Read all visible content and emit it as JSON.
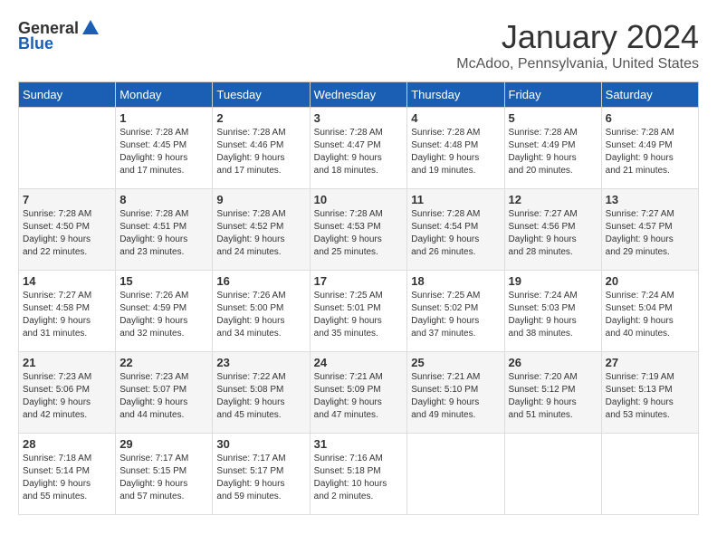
{
  "logo": {
    "general": "General",
    "blue": "Blue"
  },
  "title": "January 2024",
  "location": "McAdoo, Pennsylvania, United States",
  "days_of_week": [
    "Sunday",
    "Monday",
    "Tuesday",
    "Wednesday",
    "Thursday",
    "Friday",
    "Saturday"
  ],
  "weeks": [
    [
      {
        "day": "",
        "info": ""
      },
      {
        "day": "1",
        "info": "Sunrise: 7:28 AM\nSunset: 4:45 PM\nDaylight: 9 hours\nand 17 minutes."
      },
      {
        "day": "2",
        "info": "Sunrise: 7:28 AM\nSunset: 4:46 PM\nDaylight: 9 hours\nand 17 minutes."
      },
      {
        "day": "3",
        "info": "Sunrise: 7:28 AM\nSunset: 4:47 PM\nDaylight: 9 hours\nand 18 minutes."
      },
      {
        "day": "4",
        "info": "Sunrise: 7:28 AM\nSunset: 4:48 PM\nDaylight: 9 hours\nand 19 minutes."
      },
      {
        "day": "5",
        "info": "Sunrise: 7:28 AM\nSunset: 4:49 PM\nDaylight: 9 hours\nand 20 minutes."
      },
      {
        "day": "6",
        "info": "Sunrise: 7:28 AM\nSunset: 4:49 PM\nDaylight: 9 hours\nand 21 minutes."
      }
    ],
    [
      {
        "day": "7",
        "info": "Sunrise: 7:28 AM\nSunset: 4:50 PM\nDaylight: 9 hours\nand 22 minutes."
      },
      {
        "day": "8",
        "info": "Sunrise: 7:28 AM\nSunset: 4:51 PM\nDaylight: 9 hours\nand 23 minutes."
      },
      {
        "day": "9",
        "info": "Sunrise: 7:28 AM\nSunset: 4:52 PM\nDaylight: 9 hours\nand 24 minutes."
      },
      {
        "day": "10",
        "info": "Sunrise: 7:28 AM\nSunset: 4:53 PM\nDaylight: 9 hours\nand 25 minutes."
      },
      {
        "day": "11",
        "info": "Sunrise: 7:28 AM\nSunset: 4:54 PM\nDaylight: 9 hours\nand 26 minutes."
      },
      {
        "day": "12",
        "info": "Sunrise: 7:27 AM\nSunset: 4:56 PM\nDaylight: 9 hours\nand 28 minutes."
      },
      {
        "day": "13",
        "info": "Sunrise: 7:27 AM\nSunset: 4:57 PM\nDaylight: 9 hours\nand 29 minutes."
      }
    ],
    [
      {
        "day": "14",
        "info": "Sunrise: 7:27 AM\nSunset: 4:58 PM\nDaylight: 9 hours\nand 31 minutes."
      },
      {
        "day": "15",
        "info": "Sunrise: 7:26 AM\nSunset: 4:59 PM\nDaylight: 9 hours\nand 32 minutes."
      },
      {
        "day": "16",
        "info": "Sunrise: 7:26 AM\nSunset: 5:00 PM\nDaylight: 9 hours\nand 34 minutes."
      },
      {
        "day": "17",
        "info": "Sunrise: 7:25 AM\nSunset: 5:01 PM\nDaylight: 9 hours\nand 35 minutes."
      },
      {
        "day": "18",
        "info": "Sunrise: 7:25 AM\nSunset: 5:02 PM\nDaylight: 9 hours\nand 37 minutes."
      },
      {
        "day": "19",
        "info": "Sunrise: 7:24 AM\nSunset: 5:03 PM\nDaylight: 9 hours\nand 38 minutes."
      },
      {
        "day": "20",
        "info": "Sunrise: 7:24 AM\nSunset: 5:04 PM\nDaylight: 9 hours\nand 40 minutes."
      }
    ],
    [
      {
        "day": "21",
        "info": "Sunrise: 7:23 AM\nSunset: 5:06 PM\nDaylight: 9 hours\nand 42 minutes."
      },
      {
        "day": "22",
        "info": "Sunrise: 7:23 AM\nSunset: 5:07 PM\nDaylight: 9 hours\nand 44 minutes."
      },
      {
        "day": "23",
        "info": "Sunrise: 7:22 AM\nSunset: 5:08 PM\nDaylight: 9 hours\nand 45 minutes."
      },
      {
        "day": "24",
        "info": "Sunrise: 7:21 AM\nSunset: 5:09 PM\nDaylight: 9 hours\nand 47 minutes."
      },
      {
        "day": "25",
        "info": "Sunrise: 7:21 AM\nSunset: 5:10 PM\nDaylight: 9 hours\nand 49 minutes."
      },
      {
        "day": "26",
        "info": "Sunrise: 7:20 AM\nSunset: 5:12 PM\nDaylight: 9 hours\nand 51 minutes."
      },
      {
        "day": "27",
        "info": "Sunrise: 7:19 AM\nSunset: 5:13 PM\nDaylight: 9 hours\nand 53 minutes."
      }
    ],
    [
      {
        "day": "28",
        "info": "Sunrise: 7:18 AM\nSunset: 5:14 PM\nDaylight: 9 hours\nand 55 minutes."
      },
      {
        "day": "29",
        "info": "Sunrise: 7:17 AM\nSunset: 5:15 PM\nDaylight: 9 hours\nand 57 minutes."
      },
      {
        "day": "30",
        "info": "Sunrise: 7:17 AM\nSunset: 5:17 PM\nDaylight: 9 hours\nand 59 minutes."
      },
      {
        "day": "31",
        "info": "Sunrise: 7:16 AM\nSunset: 5:18 PM\nDaylight: 10 hours\nand 2 minutes."
      },
      {
        "day": "",
        "info": ""
      },
      {
        "day": "",
        "info": ""
      },
      {
        "day": "",
        "info": ""
      }
    ]
  ]
}
